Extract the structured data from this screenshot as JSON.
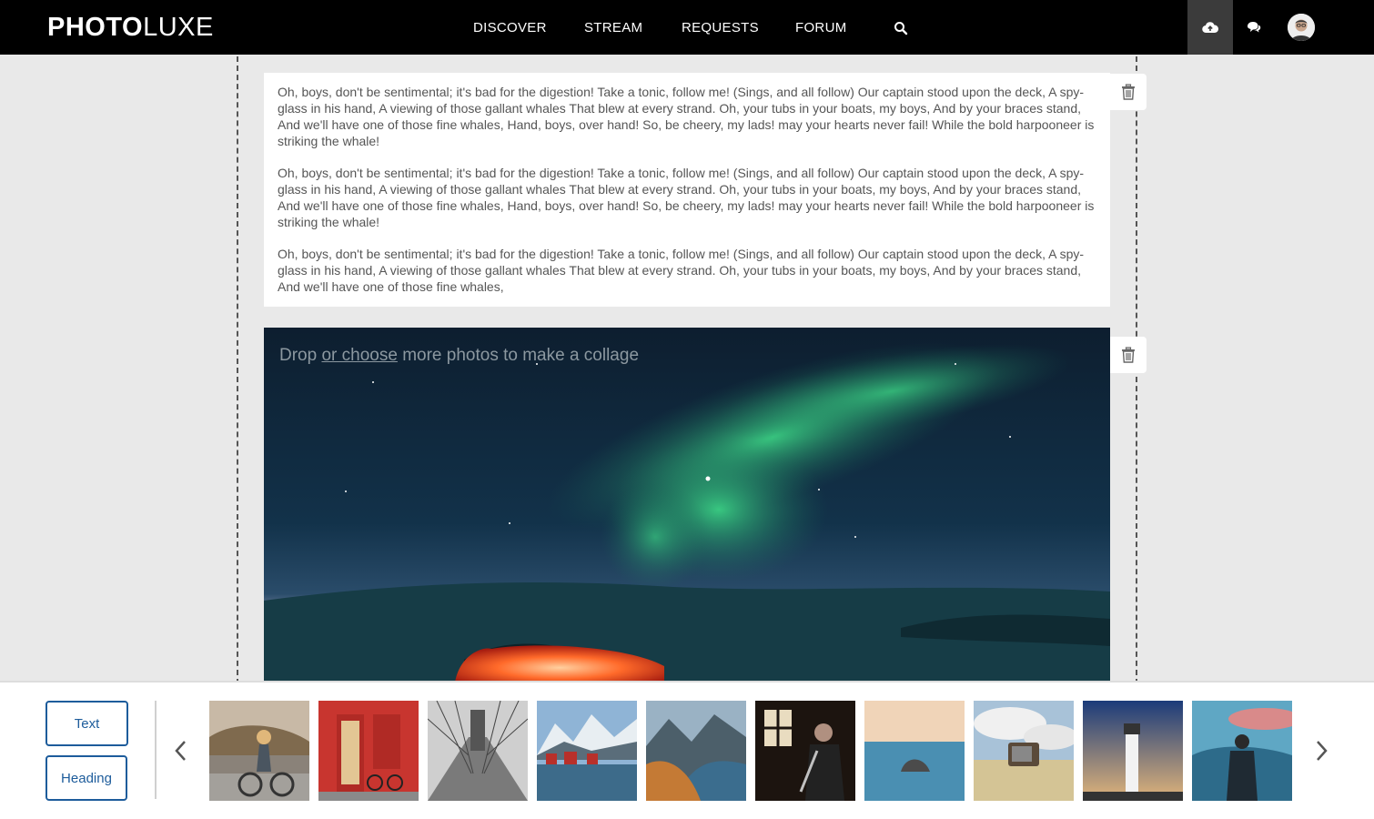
{
  "brand": {
    "bold": "PHOTO",
    "light": "LUXE"
  },
  "nav": {
    "discover": "DISCOVER",
    "stream": "STREAM",
    "requests": "REQUESTS",
    "forum": "FORUM"
  },
  "icons": {
    "search": "search-icon",
    "upload": "cloud-upload-icon",
    "chat": "chat-bubbles-icon",
    "trash": "trash-icon",
    "prev": "chevron-left-icon",
    "next": "chevron-right-icon"
  },
  "text_block": {
    "paragraphs": [
      "Oh, boys, don't be sentimental; it's bad for the digestion! Take a tonic, follow me! (Sings, and all follow) Our captain stood upon the deck, A spy-glass in his hand, A viewing of those gallant whales That blew at every strand. Oh, your tubs in your boats, my boys, And by your braces stand, And we'll have one of those fine whales, Hand, boys, over hand! So, be cheery, my lads! may your hearts never fail! While the bold harpooneer is striking the whale!",
      "Oh, boys, don't be sentimental; it's bad for the digestion! Take a tonic, follow me! (Sings, and all follow) Our captain stood upon the deck, A spy-glass in his hand, A viewing of those gallant whales That blew at every strand. Oh, your tubs in your boats, my boys, And by your braces stand, And we'll have one of those fine whales, Hand, boys, over hand! So, be cheery, my lads! may your hearts never fail! While the bold harpooneer is striking the whale!",
      "Oh, boys, don't be sentimental; it's bad for the digestion! Take a tonic, follow me! (Sings, and all follow) Our captain stood upon the deck, A spy-glass in his hand, A viewing of those gallant whales That blew at every strand. Oh, your tubs in your boats, my boys, And by your braces stand, And we'll have one of those fine whales,"
    ]
  },
  "photo_block": {
    "drop_prefix": "Drop ",
    "drop_link": "or choose",
    "drop_suffix": " more photos to make a collage"
  },
  "tools": {
    "text": "Text",
    "heading": "Heading"
  },
  "colors": {
    "accent": "#1d5c9b",
    "topbar": "#000000",
    "page_bg": "#e9e9e9"
  }
}
